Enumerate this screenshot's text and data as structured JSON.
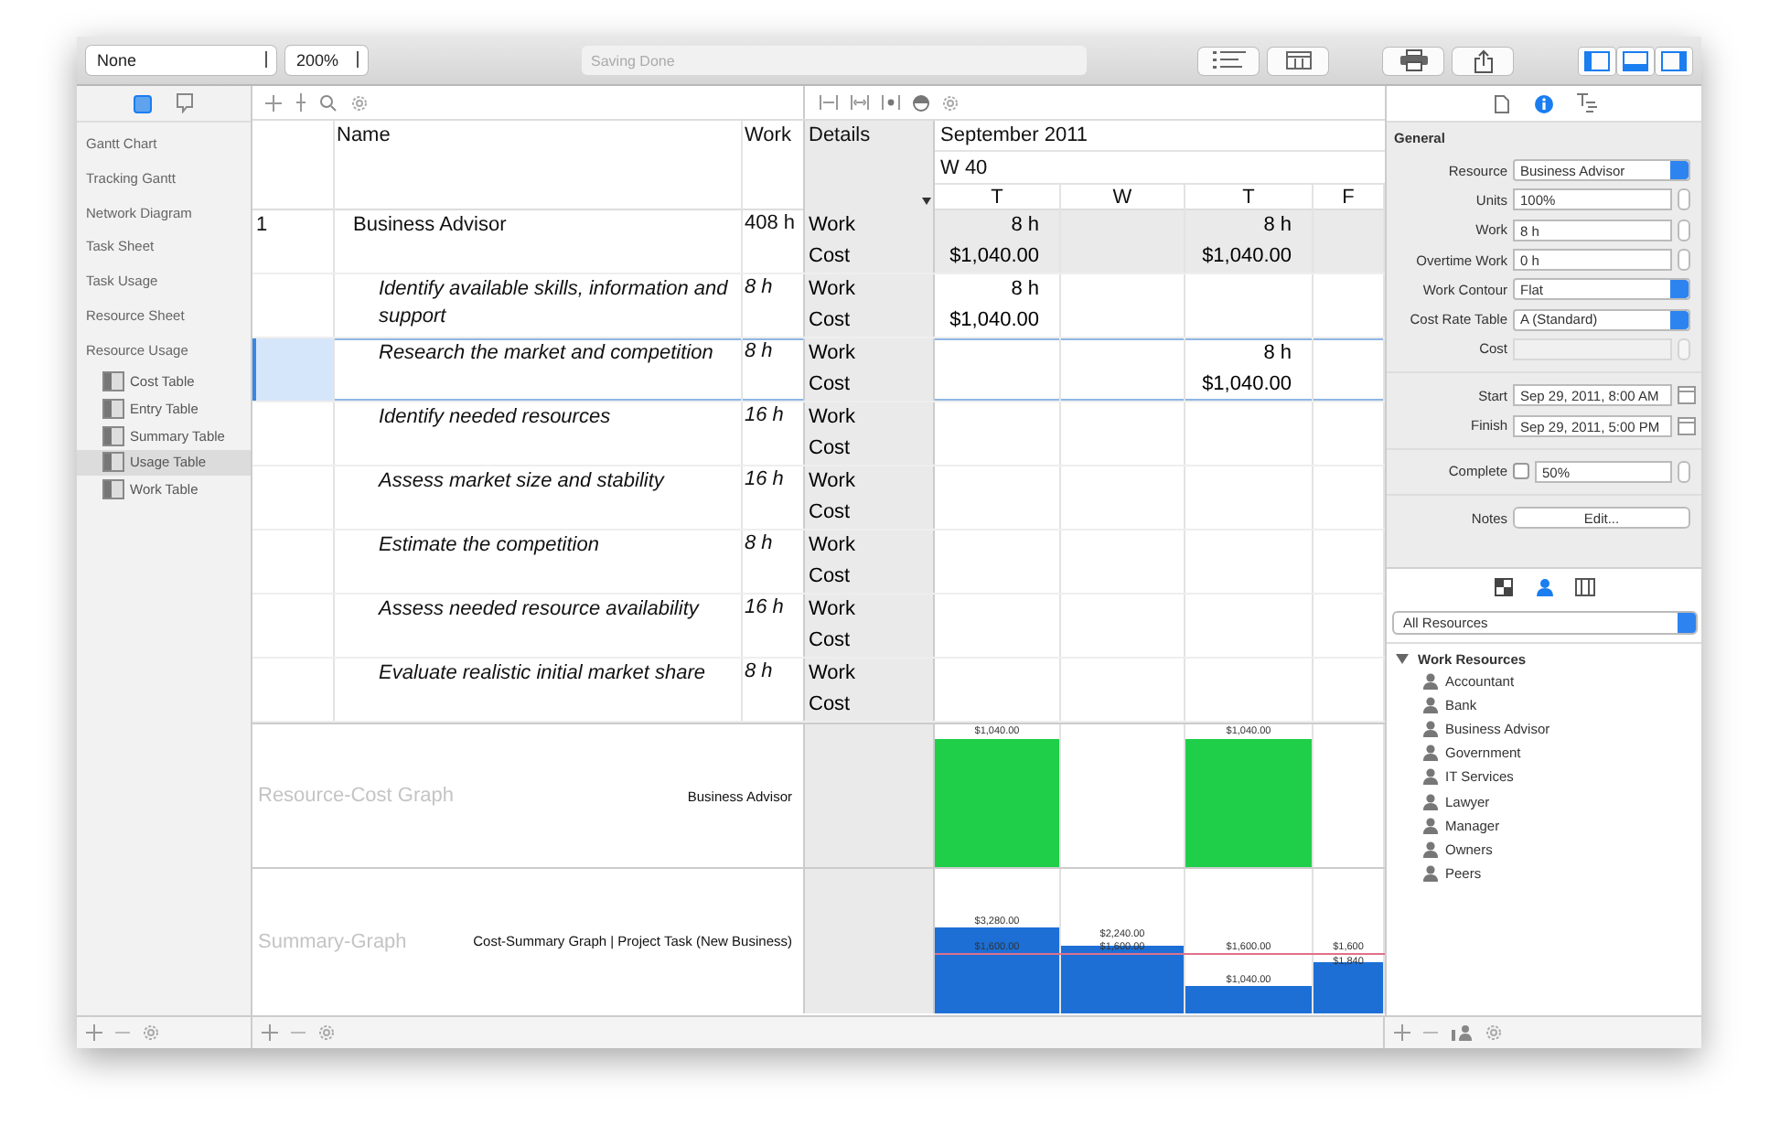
{
  "toolbar": {
    "filter": "None",
    "zoom": "200%",
    "status": "Saving Done"
  },
  "sidebar": {
    "tabs": [
      {
        "selected": true
      },
      {
        "selected": false
      }
    ],
    "items": [
      {
        "label": "Gantt Chart",
        "selected": false
      },
      {
        "label": "Tracking Gantt",
        "selected": false
      },
      {
        "label": "Network Diagram",
        "selected": false
      },
      {
        "label": "Task Sheet",
        "selected": false
      },
      {
        "label": "Task Usage",
        "selected": false
      },
      {
        "label": "Resource Sheet",
        "selected": false
      },
      {
        "label": "Resource Usage",
        "selected": false,
        "children": [
          {
            "label": "Cost Table",
            "selected": false
          },
          {
            "label": "Entry Table",
            "selected": false
          },
          {
            "label": "Summary Table",
            "selected": false
          },
          {
            "label": "Usage Table",
            "selected": true
          },
          {
            "label": "Work Table",
            "selected": false
          }
        ]
      }
    ]
  },
  "table": {
    "columns": [
      "Name",
      "Work",
      "Details"
    ],
    "month": "September 2011",
    "week": "W 40",
    "days": [
      "T",
      "W",
      "T",
      "F"
    ],
    "rows": [
      {
        "id": "1",
        "name": "Business Advisor",
        "work": "408 h",
        "selected": false,
        "details": [
          {
            "label": "Work",
            "cells": [
              "8 h",
              null,
              "8 h",
              null
            ]
          },
          {
            "label": "Cost",
            "cells": [
              "$1,040.00",
              null,
              "$1,040.00",
              null
            ]
          }
        ],
        "children": [
          {
            "name": "Identify available skills, information and support",
            "work": "8 h",
            "selected": false,
            "details": [
              {
                "label": "Work",
                "cells": [
                  "8 h",
                  null,
                  null,
                  null
                ]
              },
              {
                "label": "Cost",
                "cells": [
                  "$1,040.00",
                  null,
                  null,
                  null
                ]
              }
            ]
          },
          {
            "name": "Research the market and competition",
            "work": "8 h",
            "selected": true,
            "details": [
              {
                "label": "Work",
                "cells": [
                  null,
                  null,
                  "8 h",
                  null
                ]
              },
              {
                "label": "Cost",
                "cells": [
                  null,
                  null,
                  "$1,040.00",
                  null
                ]
              }
            ]
          },
          {
            "name": "Identify needed resources",
            "work": "16 h",
            "selected": false,
            "details": [
              {
                "label": "Work",
                "cells": [
                  null,
                  null,
                  null,
                  null
                ]
              },
              {
                "label": "Cost",
                "cells": [
                  null,
                  null,
                  null,
                  null
                ]
              }
            ]
          },
          {
            "name": "Assess market size and stability",
            "work": "16 h",
            "selected": false,
            "details": [
              {
                "label": "Work",
                "cells": [
                  null,
                  null,
                  null,
                  null
                ]
              },
              {
                "label": "Cost",
                "cells": [
                  null,
                  null,
                  null,
                  null
                ]
              }
            ]
          },
          {
            "name": "Estimate the competition",
            "work": "8 h",
            "selected": false,
            "details": [
              {
                "label": "Work",
                "cells": [
                  null,
                  null,
                  null,
                  null
                ]
              },
              {
                "label": "Cost",
                "cells": [
                  null,
                  null,
                  null,
                  null
                ]
              }
            ]
          },
          {
            "name": "Assess needed resource availability",
            "work": "16 h",
            "selected": false,
            "details": [
              {
                "label": "Work",
                "cells": [
                  null,
                  null,
                  null,
                  null
                ]
              },
              {
                "label": "Cost",
                "cells": [
                  null,
                  null,
                  null,
                  null
                ]
              }
            ]
          },
          {
            "name": "Evaluate realistic initial market share",
            "work": "8 h",
            "selected": false,
            "details": [
              {
                "label": "Work",
                "cells": [
                  null,
                  null,
                  null,
                  null
                ]
              },
              {
                "label": "Cost",
                "cells": [
                  null,
                  null,
                  null,
                  null
                ]
              }
            ]
          }
        ]
      }
    ]
  },
  "graphs": [
    {
      "title": "Resource-Cost Graph",
      "subtitle": "Business Advisor",
      "color": "#1fcf4a",
      "bars": [
        {
          "kind": "bar",
          "level": 0.9,
          "label": "$1,040.00"
        },
        {
          "kind": "empty"
        },
        {
          "kind": "bar",
          "level": 0.9,
          "label": "$1,040.00"
        },
        {
          "kind": "empty"
        }
      ]
    },
    {
      "title": "Summary-Graph",
      "subtitle": "Cost-Summary Graph | Project Task (New Business)",
      "color": "#1d6fd6",
      "bars": [
        {
          "kind": "bar",
          "level": 0.59,
          "label": "$3,280.00"
        },
        {
          "kind": "bar",
          "level": 0.47,
          "label": "$2,240.00"
        },
        {
          "kind": "bar",
          "level": 0.19,
          "label": "$1,040.00"
        },
        {
          "kind": "bar",
          "level": 0.35,
          "label": "$1,840"
        }
      ],
      "line": {
        "level": 0.4,
        "color": "#e0708a",
        "labels": [
          "$1,600.00",
          "$1,600.00",
          "$1,600.00",
          "$1,600"
        ]
      }
    }
  ],
  "inspector": {
    "tabs": [
      {
        "selected": false
      },
      {
        "selected": true
      },
      {
        "selected": false
      }
    ],
    "section": "General",
    "groups": [
      [
        {
          "label": "Resource",
          "kind": "select",
          "value": "Business Advisor"
        },
        {
          "label": "Units",
          "kind": "stepper",
          "value": "100%"
        },
        {
          "label": "Work",
          "kind": "stepper",
          "value": "8 h"
        },
        {
          "label": "Overtime Work",
          "kind": "stepper",
          "value": "0 h"
        },
        {
          "label": "Work Contour",
          "kind": "select",
          "value": "Flat"
        },
        {
          "label": "Cost Rate Table",
          "kind": "select",
          "value": "A (Standard)"
        },
        {
          "label": "Cost",
          "kind": "stepper",
          "disabled": true
        }
      ],
      [
        {
          "label": "Start",
          "kind": "date",
          "value": "Sep 29, 2011, 8:00 AM"
        },
        {
          "label": "Finish",
          "kind": "date",
          "value": "Sep 29, 2011, 5:00 PM"
        }
      ],
      [
        {
          "label": "Complete",
          "kind": "checkstepper",
          "checked": false,
          "value": "50%"
        }
      ],
      [
        {
          "label": "Notes",
          "kind": "button",
          "value": "Edit..."
        }
      ]
    ],
    "resource_tabs": [
      {
        "selected": false
      },
      {
        "selected": true
      },
      {
        "selected": false
      }
    ],
    "resource_filter": "All Resources",
    "resources": [
      {
        "label": "Work Resources",
        "expanded": true,
        "children": [
          {
            "label": "Accountant"
          },
          {
            "label": "Bank"
          },
          {
            "label": "Business Advisor"
          },
          {
            "label": "Government"
          },
          {
            "label": "IT Services"
          },
          {
            "label": "Lawyer"
          },
          {
            "label": "Manager"
          },
          {
            "label": "Owners"
          },
          {
            "label": "Peers"
          }
        ]
      }
    ]
  }
}
